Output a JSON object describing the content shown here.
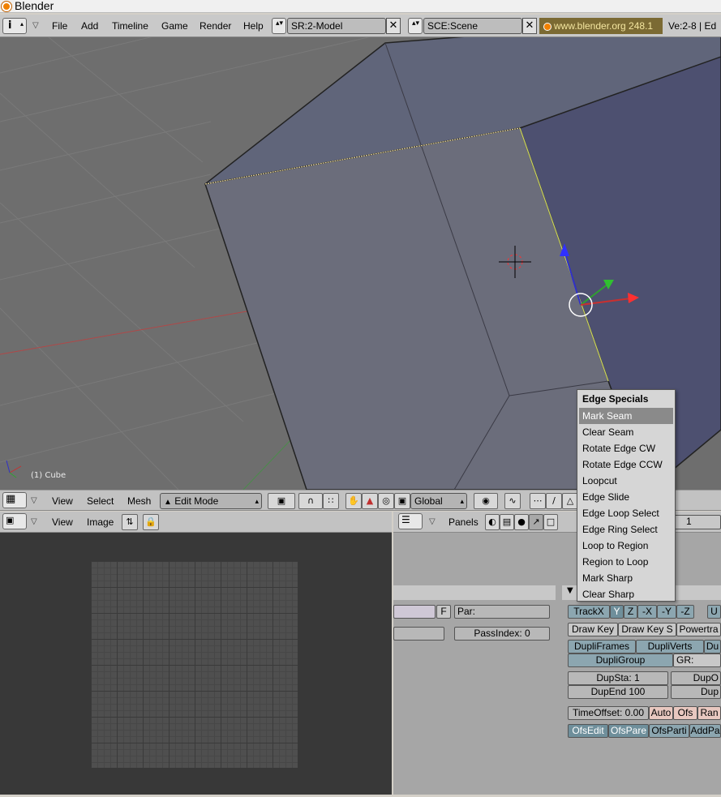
{
  "window": {
    "title": "Blender"
  },
  "header": {
    "menus": [
      "File",
      "Add",
      "Timeline",
      "Game",
      "Render",
      "Help"
    ],
    "screen_field": "SR:2-Model",
    "scene_field": "SCE:Scene",
    "url": "www.blender.org 248.1",
    "version": "Ve:2-8 | Ed"
  },
  "viewport": {
    "object_label": "(1) Cube",
    "toolbar": {
      "menus": [
        "View",
        "Select",
        "Mesh"
      ],
      "mode": "Edit Mode",
      "orientation": "Global"
    }
  },
  "popup_menu": {
    "title": "Edge Specials",
    "items": [
      "Mark Seam",
      "Clear Seam",
      "Rotate Edge CW",
      "Rotate Edge CCW",
      "Loopcut",
      "Edge Slide",
      "Edge Loop Select",
      "Edge Ring Select",
      "Loop to Region",
      "Region to Loop",
      "Mark Sharp",
      "Clear Sharp"
    ],
    "active_item": "Mark Seam"
  },
  "image_editor": {
    "menus": [
      "View",
      "Image"
    ]
  },
  "buttons_window": {
    "panels_label": "Panels",
    "frame_value": "1",
    "left_col": {
      "f_button": "F",
      "par_label": "Par:",
      "passindex": "PassIndex: 0"
    },
    "right_col": {
      "track": [
        "TrackX",
        "Y",
        "Z",
        "-X",
        "-Y",
        "-Z",
        "U"
      ],
      "draw_key": "Draw Key",
      "draw_key_s": "Draw Key S",
      "powertrack": "Powertra",
      "dupliframes": "DupliFrames",
      "dupliverts": "DupliVerts",
      "du": "Du",
      "dupligroup": "DupliGroup",
      "gr": "GR:",
      "dupsta": "DupSta: 1",
      "dupo": "DupO",
      "dupend": "DupEnd 100",
      "dup": "Dup",
      "timeoffset": "TimeOffset: 0.00",
      "auto": "Auto",
      "ofs": "Ofs",
      "ran": "Ran",
      "ofsedit": "OfsEdit",
      "ofspare": "OfsPare",
      "ofsparti": "OfsParti",
      "addpa": "AddPa"
    }
  }
}
